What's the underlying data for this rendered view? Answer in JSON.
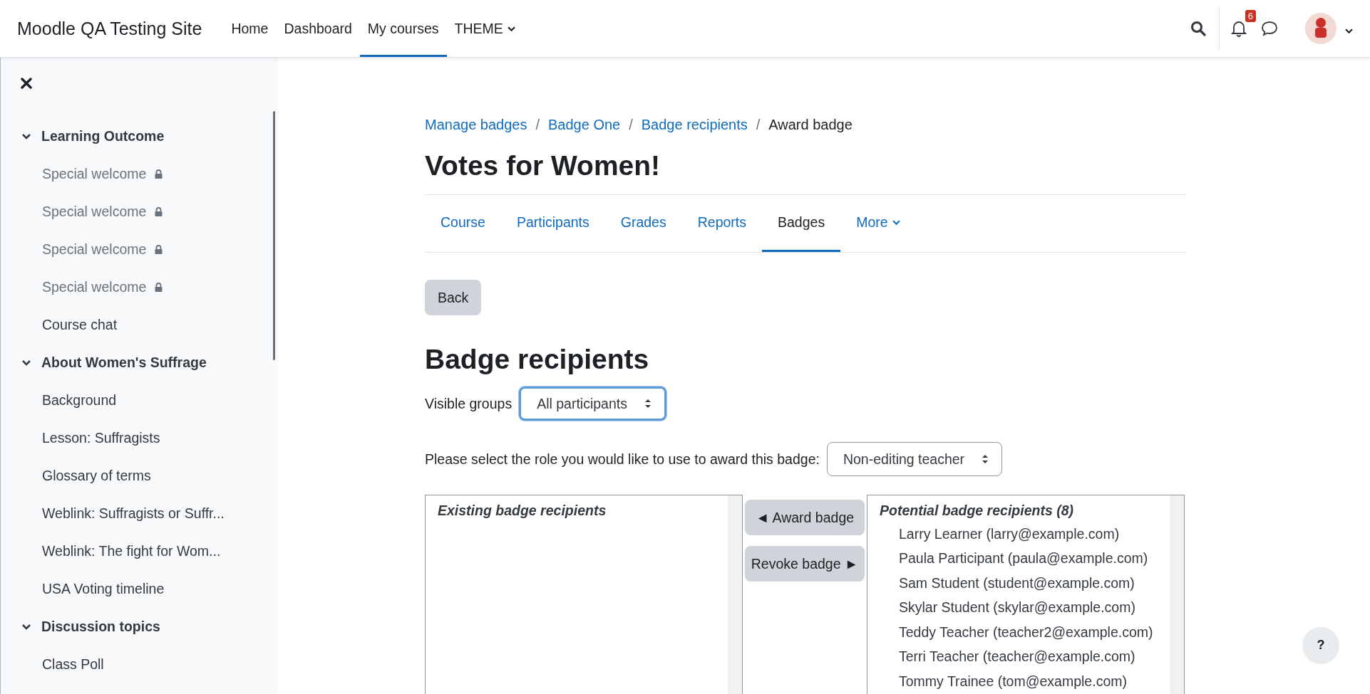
{
  "navbar": {
    "site_name": "Moodle QA Testing Site",
    "items": [
      {
        "label": "Home",
        "selected": false,
        "dropdown": false
      },
      {
        "label": "Dashboard",
        "selected": false,
        "dropdown": false
      },
      {
        "label": "My courses",
        "selected": true,
        "dropdown": false
      },
      {
        "label": "THEME",
        "selected": false,
        "dropdown": true
      }
    ],
    "notification_count": "6"
  },
  "sidebar": {
    "sections": [
      {
        "title": "Learning Outcome",
        "expanded": true,
        "items": [
          {
            "label": "Special welcome",
            "restricted": true
          },
          {
            "label": "Special welcome",
            "restricted": true
          },
          {
            "label": "Special welcome",
            "restricted": true
          },
          {
            "label": "Special welcome",
            "restricted": true
          },
          {
            "label": "Course chat",
            "restricted": false
          }
        ]
      },
      {
        "title": "About Women's Suffrage",
        "expanded": true,
        "items": [
          {
            "label": "Background",
            "restricted": false
          },
          {
            "label": "Lesson: Suffragists",
            "restricted": false
          },
          {
            "label": "Glossary of terms",
            "restricted": false
          },
          {
            "label": "Weblink: Suffragists or Suffr...",
            "restricted": false
          },
          {
            "label": "Weblink: The fight for Wom...",
            "restricted": false
          },
          {
            "label": "USA Voting timeline",
            "restricted": false
          }
        ]
      },
      {
        "title": "Discussion topics",
        "expanded": true,
        "items": [
          {
            "label": "Class Poll",
            "restricted": false
          }
        ]
      }
    ]
  },
  "breadcrumb": [
    {
      "label": "Manage badges",
      "link": true
    },
    {
      "separator": "/",
      "label": "Badge One",
      "link": true
    },
    {
      "separator": "/",
      "label": "Badge recipients",
      "link": true
    },
    {
      "separator": "/",
      "label": "Award badge",
      "link": false
    }
  ],
  "course_title": "Votes for Women!",
  "tabs": [
    {
      "label": "Course",
      "selected": false,
      "dropdown": false
    },
    {
      "label": "Participants",
      "selected": false,
      "dropdown": false
    },
    {
      "label": "Grades",
      "selected": false,
      "dropdown": false
    },
    {
      "label": "Reports",
      "selected": false,
      "dropdown": false
    },
    {
      "label": "Badges",
      "selected": true,
      "dropdown": false
    },
    {
      "label": "More",
      "selected": false,
      "dropdown": true
    }
  ],
  "back_button": "Back",
  "heading": "Badge recipients",
  "visible_groups": {
    "label": "Visible groups",
    "value": "All participants",
    "focused": true
  },
  "role_select": {
    "label": "Please select the role you would like to use to award this badge:",
    "value": "Non-editing teacher",
    "focused": false
  },
  "existing": {
    "label": "Existing badge recipients"
  },
  "award_button": "◄ Award badge",
  "revoke_button": "Revoke badge ►",
  "potential": {
    "label": "Potential badge recipients (8)",
    "options": [
      "Larry Learner (larry@example.com)",
      "Paula Participant (paula@example.com)",
      "Sam Student (student@example.com)",
      "Skylar Student (skylar@example.com)",
      "Teddy Teacher (teacher2@example.com)",
      "Terri Teacher (teacher@example.com)",
      "Tommy Trainee (tom@example.com)"
    ]
  },
  "help_button": "?"
}
